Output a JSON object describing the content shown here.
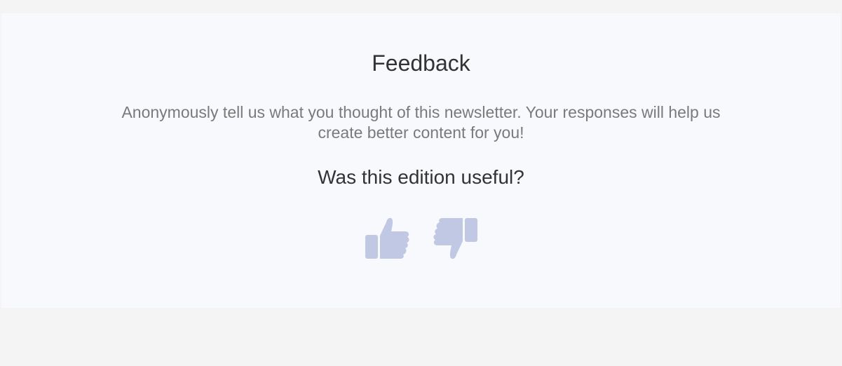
{
  "feedback": {
    "title": "Feedback",
    "description": "Anonymously tell us what you thought of this newsletter. Your responses will help us create better content for you!",
    "question": "Was this edition useful?",
    "thumbs_up_icon": "thumbs-up-icon",
    "thumbs_down_icon": "thumbs-down-icon",
    "icon_color": "#c0c8e4"
  }
}
